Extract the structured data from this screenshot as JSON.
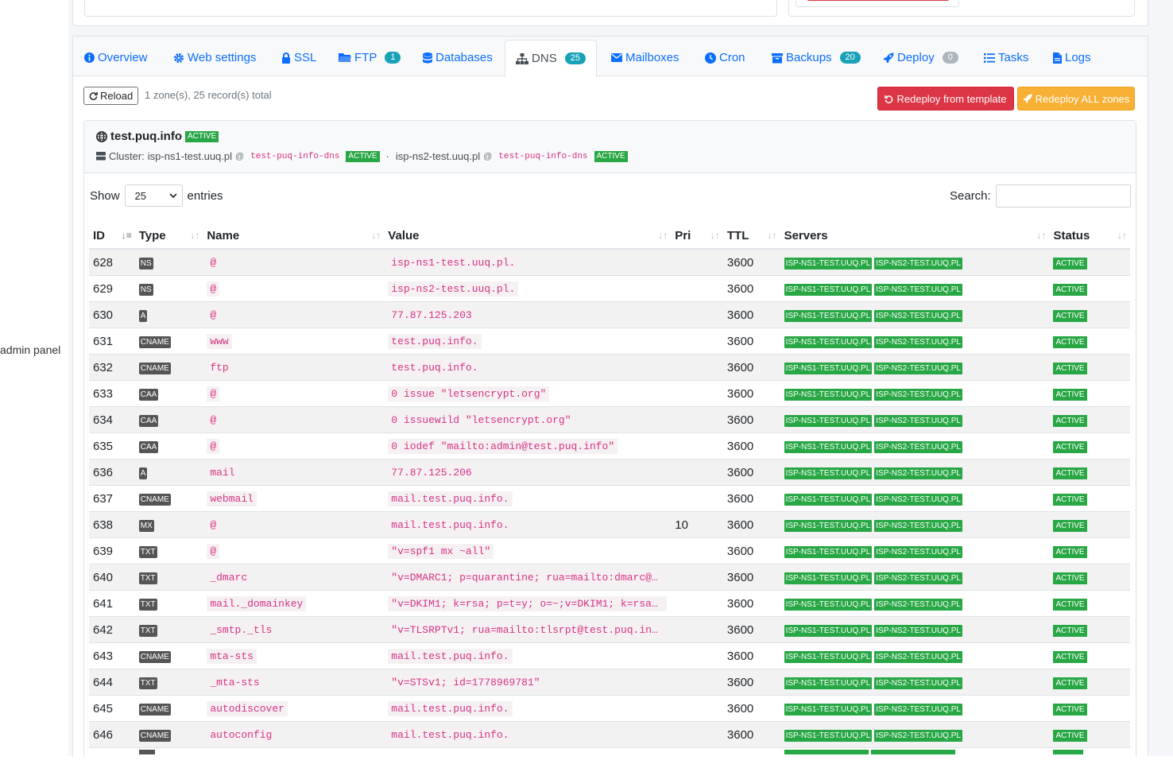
{
  "side": {
    "partial_text": "admin panel"
  },
  "tabs": [
    {
      "label": "Overview",
      "icon": "info-icon"
    },
    {
      "label": "Web settings",
      "icon": "gear-icon"
    },
    {
      "label": "SSL",
      "icon": "lock-icon"
    },
    {
      "label": "FTP",
      "icon": "folder-icon",
      "badge": "1"
    },
    {
      "label": "Databases",
      "icon": "database-icon"
    },
    {
      "label": "DNS",
      "icon": "sitemap-icon",
      "badge": "25",
      "active": true
    },
    {
      "label": "Mailboxes",
      "icon": "envelope-icon"
    },
    {
      "label": "Cron",
      "icon": "clock-icon"
    },
    {
      "label": "Backups",
      "icon": "archive-icon",
      "badge": "20"
    },
    {
      "label": "Deploy",
      "icon": "rocket-icon",
      "badge": "0"
    },
    {
      "label": "Tasks",
      "icon": "list-icon"
    },
    {
      "label": "Logs",
      "icon": "file-icon"
    }
  ],
  "toolbar": {
    "reload_label": "Reload",
    "summary": "1 zone(s), 25 record(s) total",
    "redeploy_template_label": "Redeploy from template",
    "redeploy_all_label": "Redeploy ALL zones"
  },
  "zone": {
    "name": "test.puq.info",
    "status": "ACTIVE",
    "cluster_label": "Cluster:",
    "ns1_host": "isp-ns1-test.uuq.pl",
    "ns1_zone": "test-puq-info-dns",
    "ns1_status": "ACTIVE",
    "separator": "·",
    "ns2_host": "isp-ns2-test.uuq.pl",
    "ns2_zone": "test-puq-info-dns",
    "ns2_status": "ACTIVE",
    "at": "@"
  },
  "table_controls": {
    "show_label": "Show",
    "page_size": "25",
    "entries_label": "entries",
    "search_label": "Search:"
  },
  "columns": [
    "ID",
    "Type",
    "Name",
    "Value",
    "Pri",
    "TTL",
    "Servers",
    "Status"
  ],
  "server_names": [
    "ISP-NS1-TEST.UUQ.PL",
    "ISP-NS2-TEST.UUQ.PL"
  ],
  "rows": [
    {
      "id": "628",
      "type": "NS",
      "name": "@",
      "value": "isp-ns1-test.uuq.pl.",
      "pri": "",
      "ttl": "3600",
      "status": "ACTIVE"
    },
    {
      "id": "629",
      "type": "NS",
      "name": "@",
      "value": "isp-ns2-test.uuq.pl.",
      "pri": "",
      "ttl": "3600",
      "status": "ACTIVE"
    },
    {
      "id": "630",
      "type": "A",
      "name": "@",
      "value": "77.87.125.203",
      "pri": "",
      "ttl": "3600",
      "status": "ACTIVE"
    },
    {
      "id": "631",
      "type": "CNAME",
      "name": "www",
      "value": "test.puq.info.",
      "pri": "",
      "ttl": "3600",
      "status": "ACTIVE"
    },
    {
      "id": "632",
      "type": "CNAME",
      "name": "ftp",
      "value": "test.puq.info.",
      "pri": "",
      "ttl": "3600",
      "status": "ACTIVE"
    },
    {
      "id": "633",
      "type": "CAA",
      "name": "@",
      "value": "0 issue \"letsencrypt.org\"",
      "pri": "",
      "ttl": "3600",
      "status": "ACTIVE"
    },
    {
      "id": "634",
      "type": "CAA",
      "name": "@",
      "value": "0 issuewild \"letsencrypt.org\"",
      "pri": "",
      "ttl": "3600",
      "status": "ACTIVE"
    },
    {
      "id": "635",
      "type": "CAA",
      "name": "@",
      "value": "0 iodef \"mailto:admin@test.puq.info\"",
      "pri": "",
      "ttl": "3600",
      "status": "ACTIVE"
    },
    {
      "id": "636",
      "type": "A",
      "name": "mail",
      "value": "77.87.125.206",
      "pri": "",
      "ttl": "3600",
      "status": "ACTIVE"
    },
    {
      "id": "637",
      "type": "CNAME",
      "name": "webmail",
      "value": "mail.test.puq.info.",
      "pri": "",
      "ttl": "3600",
      "status": "ACTIVE"
    },
    {
      "id": "638",
      "type": "MX",
      "name": "@",
      "value": "mail.test.puq.info.",
      "pri": "10",
      "ttl": "3600",
      "status": "ACTIVE"
    },
    {
      "id": "639",
      "type": "TXT",
      "name": "@",
      "value": "\"v=spf1 mx ~all\"",
      "pri": "",
      "ttl": "3600",
      "status": "ACTIVE"
    },
    {
      "id": "640",
      "type": "TXT",
      "name": "_dmarc",
      "value": "\"v=DMARC1; p=quarantine; rua=mailto:dmarc@t…",
      "pri": "",
      "ttl": "3600",
      "status": "ACTIVE"
    },
    {
      "id": "641",
      "type": "TXT",
      "name": "mail._domainkey",
      "value": "\"v=DKIM1; k=rsa; p=t=y; o=~;v=DKIM1; k=rsa;…",
      "pri": "",
      "ttl": "3600",
      "status": "ACTIVE"
    },
    {
      "id": "642",
      "type": "TXT",
      "name": "_smtp._tls",
      "value": "\"v=TLSRPTv1; rua=mailto:tlsrpt@test.puq.inf…",
      "pri": "",
      "ttl": "3600",
      "status": "ACTIVE"
    },
    {
      "id": "643",
      "type": "CNAME",
      "name": "mta-sts",
      "value": "mail.test.puq.info.",
      "pri": "",
      "ttl": "3600",
      "status": "ACTIVE"
    },
    {
      "id": "644",
      "type": "TXT",
      "name": "_mta-sts",
      "value": "\"v=STSv1; id=1778969781\"",
      "pri": "",
      "ttl": "3600",
      "status": "ACTIVE"
    },
    {
      "id": "645",
      "type": "CNAME",
      "name": "autodiscover",
      "value": "mail.test.puq.info.",
      "pri": "",
      "ttl": "3600",
      "status": "ACTIVE"
    },
    {
      "id": "646",
      "type": "CNAME",
      "name": "autoconfig",
      "value": "mail.test.puq.info.",
      "pri": "",
      "ttl": "3600",
      "status": "ACTIVE"
    }
  ],
  "colors": {
    "primary": "#0d6efd",
    "danger": "#dc3545",
    "warning": "#f8b135",
    "success": "#28a745",
    "code": "#d63384"
  }
}
